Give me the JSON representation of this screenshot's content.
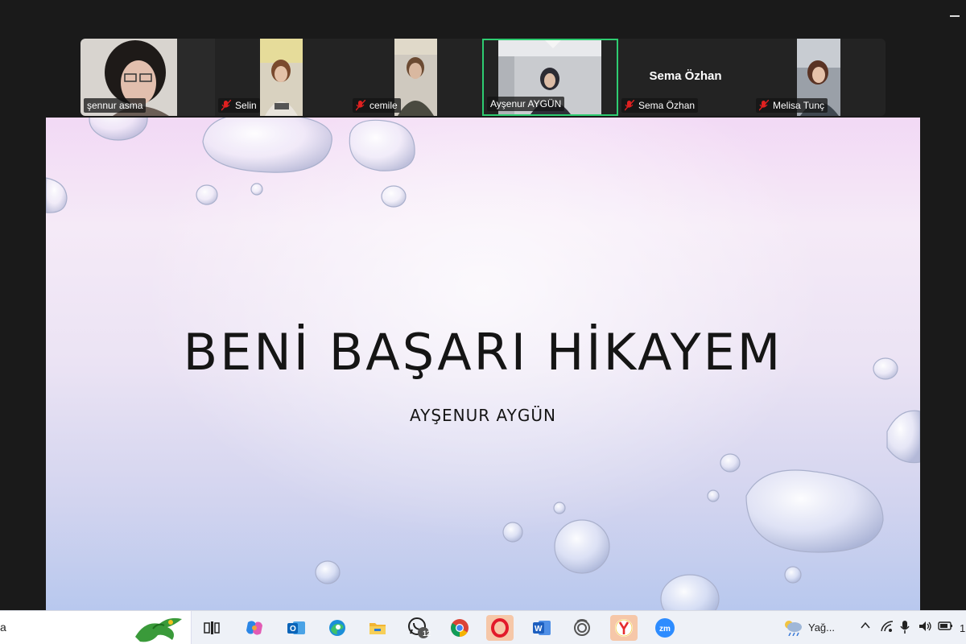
{
  "participants": [
    {
      "name": "şennur asma",
      "muted": false
    },
    {
      "name": "Selin",
      "muted": true
    },
    {
      "name": "cemile",
      "muted": true
    },
    {
      "name": "Ayşenur AYGÜN",
      "muted": false,
      "active": true
    },
    {
      "name": "Sema Özhan",
      "muted": true,
      "display_name": "Sema Özhan"
    },
    {
      "name": "Melisa Tunç",
      "muted": true
    }
  ],
  "slide": {
    "title": "BENİ BAŞARI HİKAYEM",
    "subtitle": "AYŞENUR AYGÜN"
  },
  "taskbar": {
    "search_text": "a",
    "whatsapp_badge": "12",
    "weather_text": "Yağ...",
    "clock_partial": "1",
    "apps": [
      "task-view",
      "copilot",
      "outlook",
      "edge",
      "file-explorer",
      "whatsapp",
      "chrome",
      "opera",
      "word",
      "app-ring",
      "yandex",
      "zoom"
    ]
  },
  "colors": {
    "active_speaker_border": "#2ecc71",
    "mute_red": "#e02020",
    "taskbar_bg": "#eef1f7"
  }
}
